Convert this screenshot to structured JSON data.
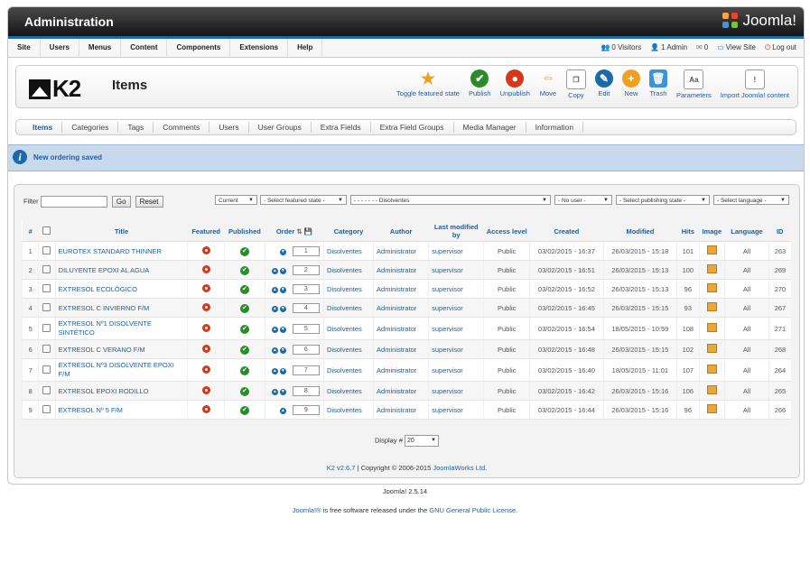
{
  "header": {
    "title": "Administration",
    "brand": "Joomla!"
  },
  "menu": [
    "Site",
    "Users",
    "Menus",
    "Content",
    "Components",
    "Extensions",
    "Help"
  ],
  "status": {
    "visitors": "0 Visitors",
    "admins": "1 Admin",
    "messages": "0",
    "view_site": "View Site",
    "logout": "Log out"
  },
  "toolbar": {
    "logo": "K2",
    "page_title": "Items",
    "tools": [
      {
        "label": "Toggle featured state",
        "icon": "star-icon",
        "color": "#f0a020",
        "glyph": "★"
      },
      {
        "label": "Publish",
        "icon": "publish-icon",
        "color": "#2a8b2a",
        "glyph": "✔"
      },
      {
        "label": "Unpublish",
        "icon": "unpublish-icon",
        "color": "#d5391b",
        "glyph": "●"
      },
      {
        "label": "Move",
        "icon": "move-icon",
        "color": "#f0a020",
        "glyph": "⇔"
      },
      {
        "label": "Copy",
        "icon": "copy-icon",
        "color": "#bbbbbb",
        "glyph": "❐"
      },
      {
        "label": "Edit",
        "icon": "edit-icon",
        "color": "#1a6aa8",
        "glyph": "✎"
      },
      {
        "label": "New",
        "icon": "new-icon",
        "color": "#f0a020",
        "glyph": "+"
      },
      {
        "label": "Trash",
        "icon": "trash-icon",
        "color": "#3b94d9",
        "glyph": "🗑"
      },
      {
        "label": "Parameters",
        "icon": "parameters-icon",
        "color": "#999999",
        "glyph": "Aa"
      },
      {
        "label": "Import Joomla! content",
        "icon": "import-icon",
        "color": "#999999",
        "glyph": "!"
      }
    ]
  },
  "subnav": [
    "Items",
    "Categories",
    "Tags",
    "Comments",
    "Users",
    "User Groups",
    "Extra Fields",
    "Extra Field Groups",
    "Media Manager",
    "Information"
  ],
  "message": "New ordering saved",
  "filters": {
    "filter_label": "Filter",
    "go": "Go",
    "reset": "Reset",
    "current": "Current",
    "featured": "- Select featured state -",
    "category": "- - - - - - - Disolventes",
    "user": "- No user -",
    "publishing": "- Select publishing state -",
    "language": "- Select language -"
  },
  "columns": [
    "#",
    "",
    "Title",
    "Featured",
    "Published",
    "Order",
    "Category",
    "Author",
    "Last modified by",
    "Access level",
    "Created",
    "Modified",
    "Hits",
    "Image",
    "Language",
    "ID"
  ],
  "rows": [
    {
      "n": "1",
      "title": "EUROTEX STANDARD THINNER",
      "order": "1",
      "category": "Disolventes",
      "author": "Administrator",
      "modby": "supervisor",
      "access": "Public",
      "created": "03/02/2015 - 16:37",
      "modified": "26/03/2015 - 15:18",
      "hits": "101",
      "language": "All",
      "id": "263",
      "up": false,
      "down": true
    },
    {
      "n": "2",
      "title": "DILUYENTE EPOXI AL AGUA",
      "order": "2",
      "category": "Disolventes",
      "author": "Administrator",
      "modby": "supervisor",
      "access": "Public",
      "created": "03/02/2015 - 16:51",
      "modified": "26/03/2015 - 15:13",
      "hits": "100",
      "language": "All",
      "id": "269",
      "up": true,
      "down": true
    },
    {
      "n": "3",
      "title": "EXTRESOL ECOLÓGICO",
      "order": "3",
      "category": "Disolventes",
      "author": "Administrator",
      "modby": "supervisor",
      "access": "Public",
      "created": "03/02/2015 - 16:52",
      "modified": "26/03/2015 - 15:13",
      "hits": "96",
      "language": "All",
      "id": "270",
      "up": true,
      "down": true
    },
    {
      "n": "4",
      "title": "EXTRESOL C INVIERNO F/M",
      "order": "4",
      "category": "Disolventes",
      "author": "Administrator",
      "modby": "supervisor",
      "access": "Public",
      "created": "03/02/2015 - 16:45",
      "modified": "26/03/2015 - 15:15",
      "hits": "93",
      "language": "All",
      "id": "267",
      "up": true,
      "down": true
    },
    {
      "n": "5",
      "title": "EXTRESOL Nº1 DISOLVENTE SINTÉTICO",
      "order": "5",
      "category": "Disolventes",
      "author": "Administrator",
      "modby": "supervisor",
      "access": "Public",
      "created": "03/02/2015 - 16:54",
      "modified": "18/05/2015 - 10:59",
      "hits": "108",
      "language": "All",
      "id": "271",
      "up": true,
      "down": true
    },
    {
      "n": "6",
      "title": "EXTRESOL C VERANO F/M",
      "order": "6",
      "category": "Disolventes",
      "author": "Administrator",
      "modby": "supervisor",
      "access": "Public",
      "created": "03/02/2015 - 16:48",
      "modified": "26/03/2015 - 15:15",
      "hits": "102",
      "language": "All",
      "id": "268",
      "up": true,
      "down": true
    },
    {
      "n": "7",
      "title": "EXTRESOL Nº3 DISOLVENTE EPOXI F/M",
      "order": "7",
      "category": "Disolventes",
      "author": "Administrator",
      "modby": "supervisor",
      "access": "Public",
      "created": "03/02/2015 - 16:40",
      "modified": "18/05/2015 - 11:01",
      "hits": "107",
      "language": "All",
      "id": "264",
      "up": true,
      "down": true
    },
    {
      "n": "8",
      "title": "EXTRESOL EPOXI RODILLO",
      "order": "8",
      "category": "Disolventes",
      "author": "Administrator",
      "modby": "supervisor",
      "access": "Public",
      "created": "03/02/2015 - 16:42",
      "modified": "26/03/2015 - 15:16",
      "hits": "106",
      "language": "All",
      "id": "265",
      "up": true,
      "down": true
    },
    {
      "n": "9",
      "title": "EXTRESOL Nº 5 F/M",
      "order": "9",
      "category": "Disolventes",
      "author": "Administrator",
      "modby": "supervisor",
      "access": "Public",
      "created": "03/02/2015 - 16:44",
      "modified": "26/03/2015 - 15:16",
      "hits": "96",
      "language": "All",
      "id": "266",
      "up": true,
      "down": false
    }
  ],
  "display": {
    "label": "Display #",
    "value": "20"
  },
  "copyright": {
    "k2": "K2 v2.6.7",
    "text": " | Copyright © 2006-2015 ",
    "company": "JoomlaWorks Ltd."
  },
  "version": "Joomla! 2.5.14",
  "license": {
    "brand": "Joomla!®",
    "text": " is free software released under the ",
    "link": "GNU General Public License",
    "end": "."
  }
}
